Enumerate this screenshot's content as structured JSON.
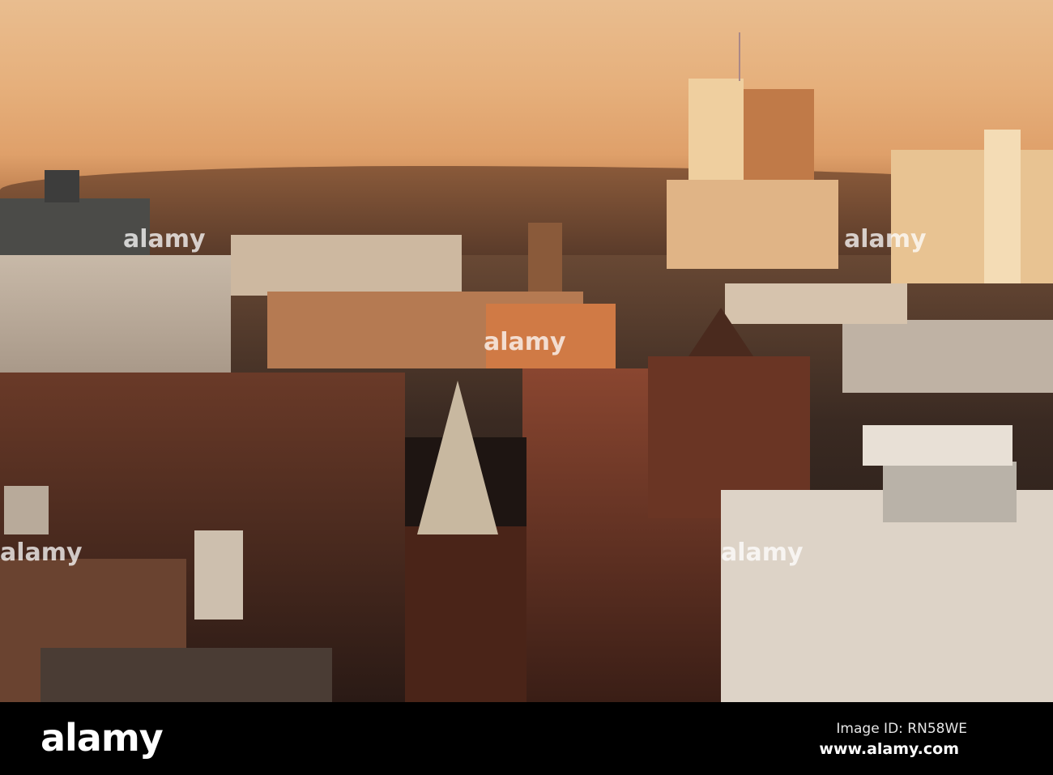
{
  "image": {
    "description_free": true
  },
  "watermark": {
    "text": "alamy"
  },
  "footer": {
    "logo": "alamy",
    "image_id": "Image ID: RN58WE",
    "url": "www.alamy.com"
  }
}
